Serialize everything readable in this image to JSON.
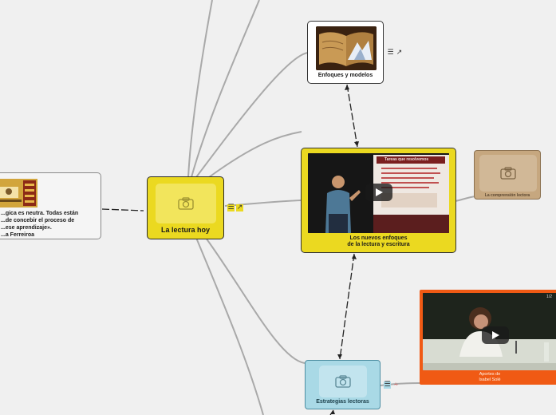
{
  "map": {
    "central": {
      "title": "La lectura hoy",
      "bg": "#ebd920"
    },
    "quote": {
      "text": "...gica es neutra. Todas están\n...de concebir el proceso de\n...ese aprendizaje».\n...a Ferreiroa"
    },
    "topics": [
      {
        "id": "enfoques",
        "title": "Enfoques y modelos",
        "bg": "#ffffff",
        "image": "open-book"
      },
      {
        "id": "nuevos",
        "title": "Los nuevos enfoques\nde la lectura y escritura",
        "bg": "#ebd920",
        "image": "video",
        "slide_title": "Tareas que resolvemos"
      },
      {
        "id": "comprension",
        "title": "La comprensión lectora",
        "bg": "#c6a77f",
        "image": "placeholder"
      },
      {
        "id": "sole",
        "title": "Aportes de\nIsabel Solé",
        "bg": "#f05a14",
        "image": "video",
        "corner": "1/2"
      },
      {
        "id": "estrategias",
        "title": "Estrategias lectoras",
        "bg": "#a9d9e6",
        "image": "placeholder"
      }
    ],
    "icons": {
      "notes": "notes-icon",
      "link": "link-icon",
      "attachment": "attachment-icon"
    },
    "colors": {
      "background": "#f0f0f0",
      "connector": "#aaaaaa",
      "relationship": "#222222"
    }
  }
}
